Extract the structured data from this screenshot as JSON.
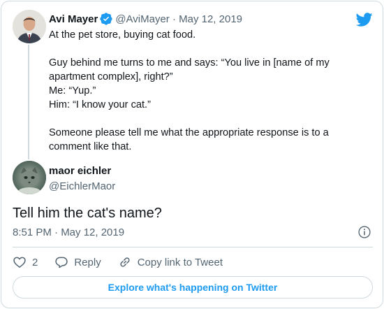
{
  "colors": {
    "accent": "#1d9bf0",
    "text_primary": "#0f1419",
    "text_secondary": "#536471",
    "border": "#cfd9de"
  },
  "parent_tweet": {
    "author_name": "Avi Mayer",
    "verified": true,
    "meta": "@AviMayer · May 12, 2019",
    "text": "At the pet store, buying cat food.\n\nGuy behind me turns to me and says: “You live in [name of my apartment complex], right?”\nMe: “Yup.”\nHim: “I know your cat.”\n\nSomeone please tell me what the appropriate response is to a comment like that."
  },
  "reply_tweet": {
    "author_name": "maor eichler",
    "handle": "@EichlerMaor",
    "text": "Tell him the cat's name?",
    "timestamp": "8:51 PM · May 12, 2019"
  },
  "actions": {
    "like_count": "2",
    "reply_label": "Reply",
    "copy_link_label": "Copy link to Tweet"
  },
  "footer": {
    "explore_label": "Explore what's happening on Twitter"
  },
  "icons": [
    "twitter-logo-icon",
    "verified-badge-icon",
    "info-icon",
    "heart-icon",
    "reply-icon",
    "link-icon"
  ]
}
